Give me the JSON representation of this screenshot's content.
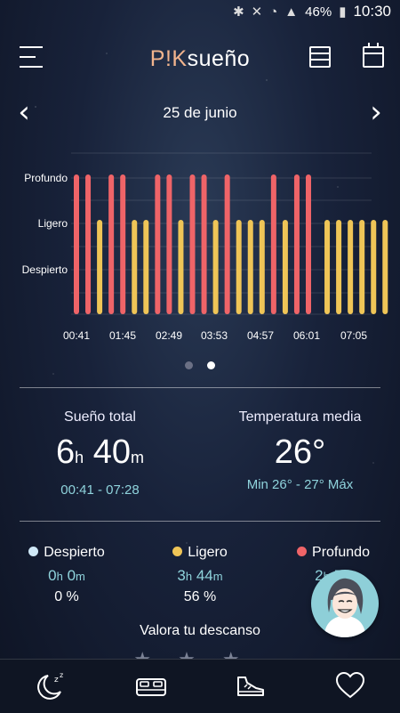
{
  "status_bar": {
    "battery": "46%",
    "time": "10:30"
  },
  "header": {
    "logo_prefix": "P!K",
    "logo_suffix": "sueño"
  },
  "date_nav": {
    "date": "25 de junio"
  },
  "chart_data": {
    "type": "bar",
    "y_levels": [
      "Despierto",
      "Ligero",
      "Profundo"
    ],
    "x_ticks": [
      "00:41",
      "01:45",
      "02:49",
      "03:53",
      "04:57",
      "06:01",
      "07:05"
    ],
    "colors": {
      "Despierto": "#cfe8f7",
      "Ligero": "#efc557",
      "Profundo": "#ef6468"
    },
    "values": [
      "Profundo",
      "Profundo",
      "Ligero",
      "Profundo",
      "Profundo",
      "Ligero",
      "Ligero",
      "Profundo",
      "Profundo",
      "Ligero",
      "Profundo",
      "Profundo",
      "Ligero",
      "Profundo",
      "Ligero",
      "Ligero",
      "Ligero",
      "Profundo",
      "Ligero",
      "Profundo",
      "Profundo",
      "Ligero",
      "Ligero",
      "Ligero",
      "Ligero",
      "Ligero",
      "Ligero"
    ]
  },
  "pager": {
    "pages": 2,
    "active": 1
  },
  "summary": {
    "total_label": "Sueño total",
    "total_hours": "6",
    "total_hours_unit": "h",
    "total_minutes": "40",
    "total_minutes_unit": "m",
    "total_range": "00:41 - 07:28",
    "temp_label": "Temperatura media",
    "temp_value": "26°",
    "temp_range": "Min 26° - 27° Máx"
  },
  "phases": [
    {
      "name": "Despierto",
      "color": "#cfe8f7",
      "hours": "0",
      "minutes": "0",
      "pct": "0 %"
    },
    {
      "name": "Ligero",
      "color": "#efc557",
      "hours": "3",
      "minutes": "44",
      "pct": "56 %"
    },
    {
      "name": "Profundo",
      "color": "#ef6468",
      "hours": "2",
      "minutes": "5",
      "pct": ""
    }
  ],
  "units": {
    "h": "h",
    "m": "m"
  },
  "rating": {
    "label": "Valora tu descanso",
    "stars": "★★★"
  },
  "tabs": [
    "sleep-icon",
    "bed-icon",
    "shoe-icon",
    "heart-icon"
  ]
}
